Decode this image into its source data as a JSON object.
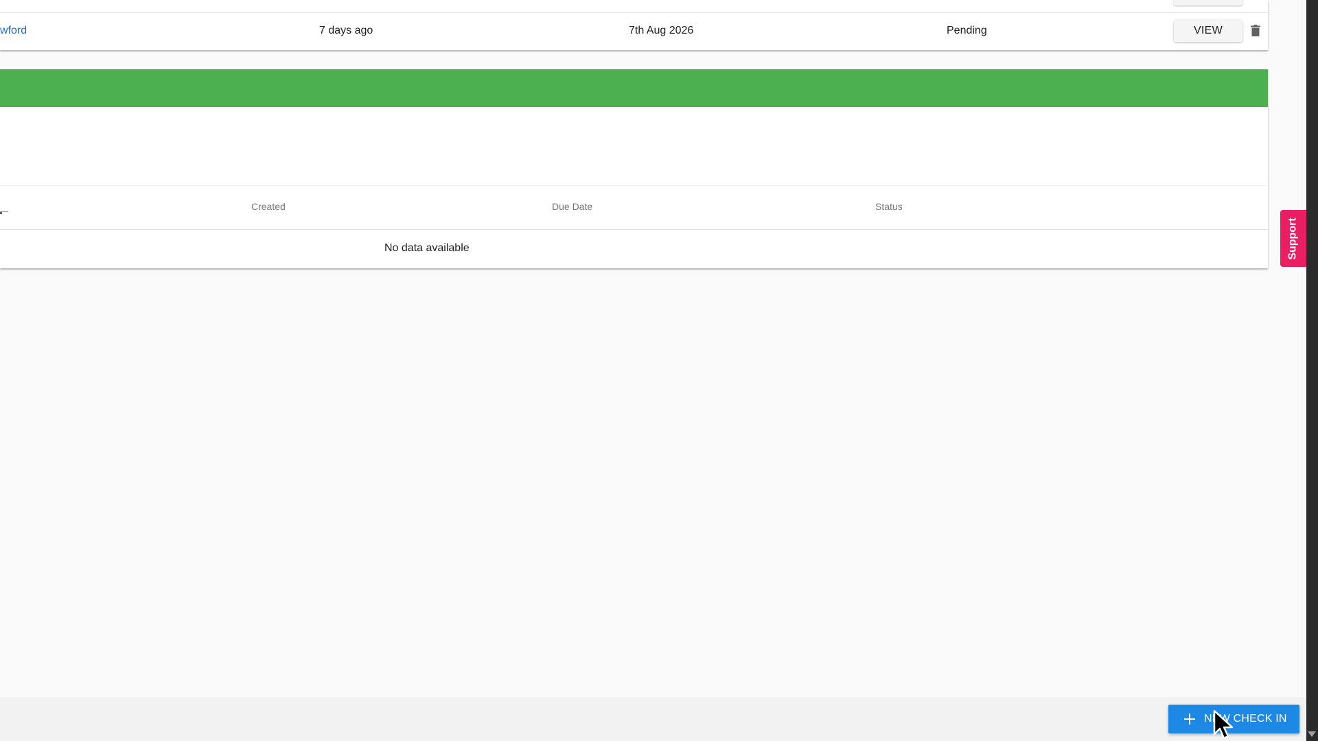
{
  "checkins_table": {
    "row": {
      "name": "wford",
      "created": "7 days ago",
      "due_date": "7th Aug 2026",
      "status": "Pending",
      "view_label": "VIEW"
    }
  },
  "second_table": {
    "headers": {
      "created": "Created",
      "due_date": "Due Date",
      "status": "Status"
    },
    "empty_message": "No data available"
  },
  "support": {
    "label": "Support"
  },
  "footer": {
    "new_checkin_label": "NEW CHECK IN"
  },
  "colors": {
    "section_header": "#4caf50",
    "primary_button": "#1e88e5",
    "support_tab": "#e91e63",
    "link": "#1e6fd0"
  },
  "icons": {
    "delete": "trash-icon",
    "add": "plus-icon",
    "scroll": "chevron-down-icon"
  }
}
